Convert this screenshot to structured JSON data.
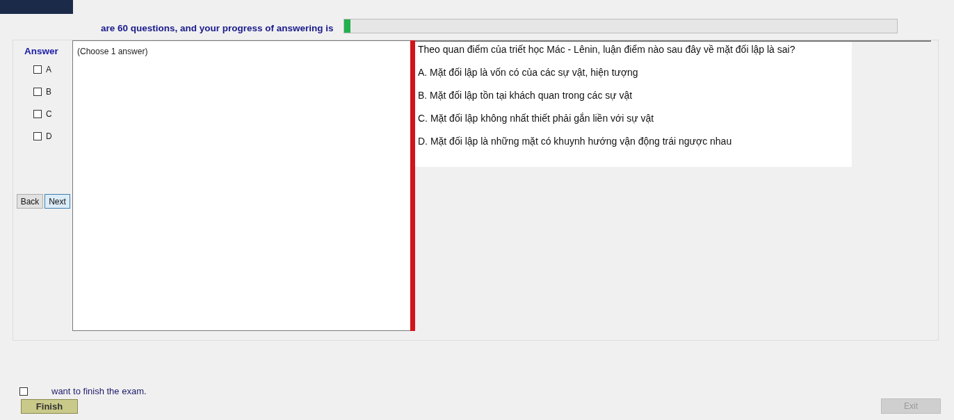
{
  "header": {
    "progress_text": "are 60 questions, and your progress of answering is",
    "progress": {
      "level": 0.012
    }
  },
  "answer_panel": {
    "title": "Answer",
    "options": [
      {
        "label": "A",
        "checked": false
      },
      {
        "label": "B",
        "checked": false
      },
      {
        "label": "C",
        "checked": false
      },
      {
        "label": "D",
        "checked": false
      }
    ],
    "buttons": [
      {
        "label": "Back",
        "selected": false
      },
      {
        "label": "Next",
        "selected": true
      }
    ]
  },
  "answer_box": {
    "hint": "(Choose 1 answer)"
  },
  "question": {
    "text": "Theo quan điểm của triết học Mác - Lênin, luận điểm nào sau đây về mặt đối lập là sai?",
    "choices": [
      "A.  Mặt đối lập là vốn có của các sự vật, hiện tượng",
      "B.  Mặt đối lập tồn tại khách quan trong các sự vật",
      "C.  Mặt đối lập không nhất thiết phải gắn liền với sự vật",
      "D.  Mặt đối lập là những mặt có khuynh hướng vận động trái ngược nhau"
    ]
  },
  "footer": {
    "confirm": {
      "label": "want to finish the exam.",
      "checked": false
    },
    "finish_button": {
      "label": "Finish",
      "disabled": false
    },
    "exit_button": {
      "label": "Exit",
      "disabled": true
    }
  }
}
